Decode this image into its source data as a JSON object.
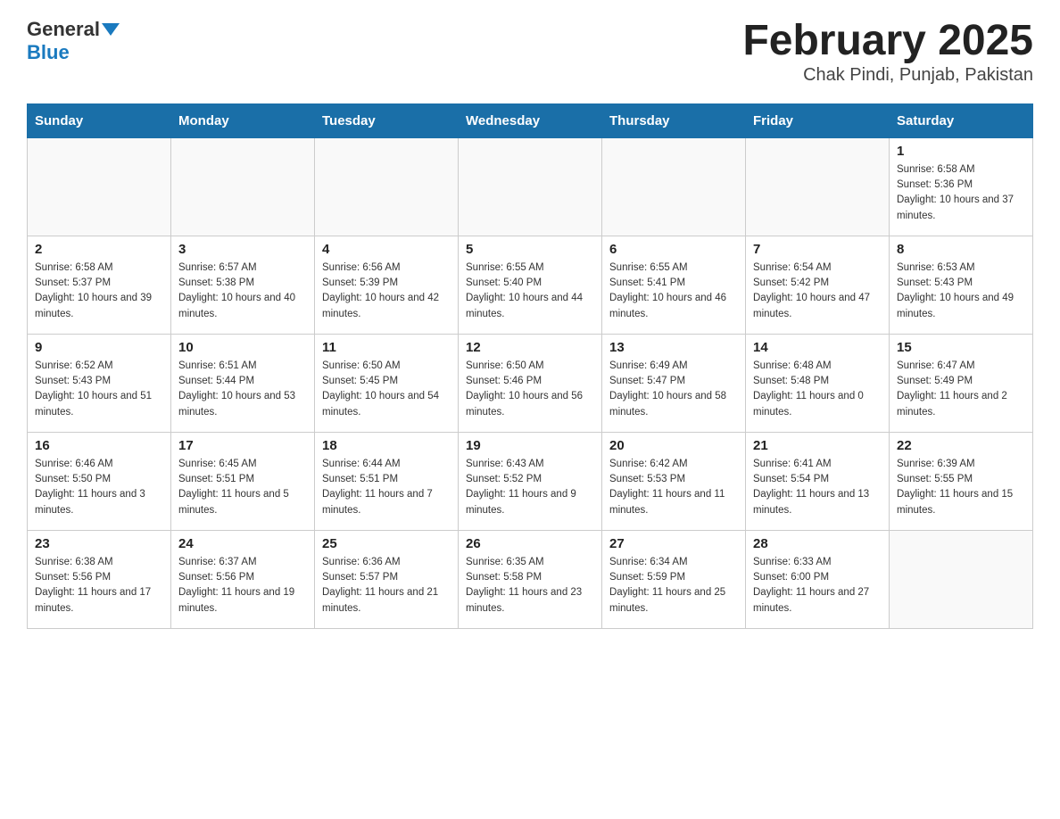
{
  "logo": {
    "text_general": "General",
    "text_blue": "Blue"
  },
  "title": "February 2025",
  "subtitle": "Chak Pindi, Punjab, Pakistan",
  "days_of_week": [
    "Sunday",
    "Monday",
    "Tuesday",
    "Wednesday",
    "Thursday",
    "Friday",
    "Saturday"
  ],
  "weeks": [
    [
      {
        "day": "",
        "info": ""
      },
      {
        "day": "",
        "info": ""
      },
      {
        "day": "",
        "info": ""
      },
      {
        "day": "",
        "info": ""
      },
      {
        "day": "",
        "info": ""
      },
      {
        "day": "",
        "info": ""
      },
      {
        "day": "1",
        "info": "Sunrise: 6:58 AM\nSunset: 5:36 PM\nDaylight: 10 hours and 37 minutes."
      }
    ],
    [
      {
        "day": "2",
        "info": "Sunrise: 6:58 AM\nSunset: 5:37 PM\nDaylight: 10 hours and 39 minutes."
      },
      {
        "day": "3",
        "info": "Sunrise: 6:57 AM\nSunset: 5:38 PM\nDaylight: 10 hours and 40 minutes."
      },
      {
        "day": "4",
        "info": "Sunrise: 6:56 AM\nSunset: 5:39 PM\nDaylight: 10 hours and 42 minutes."
      },
      {
        "day": "5",
        "info": "Sunrise: 6:55 AM\nSunset: 5:40 PM\nDaylight: 10 hours and 44 minutes."
      },
      {
        "day": "6",
        "info": "Sunrise: 6:55 AM\nSunset: 5:41 PM\nDaylight: 10 hours and 46 minutes."
      },
      {
        "day": "7",
        "info": "Sunrise: 6:54 AM\nSunset: 5:42 PM\nDaylight: 10 hours and 47 minutes."
      },
      {
        "day": "8",
        "info": "Sunrise: 6:53 AM\nSunset: 5:43 PM\nDaylight: 10 hours and 49 minutes."
      }
    ],
    [
      {
        "day": "9",
        "info": "Sunrise: 6:52 AM\nSunset: 5:43 PM\nDaylight: 10 hours and 51 minutes."
      },
      {
        "day": "10",
        "info": "Sunrise: 6:51 AM\nSunset: 5:44 PM\nDaylight: 10 hours and 53 minutes."
      },
      {
        "day": "11",
        "info": "Sunrise: 6:50 AM\nSunset: 5:45 PM\nDaylight: 10 hours and 54 minutes."
      },
      {
        "day": "12",
        "info": "Sunrise: 6:50 AM\nSunset: 5:46 PM\nDaylight: 10 hours and 56 minutes."
      },
      {
        "day": "13",
        "info": "Sunrise: 6:49 AM\nSunset: 5:47 PM\nDaylight: 10 hours and 58 minutes."
      },
      {
        "day": "14",
        "info": "Sunrise: 6:48 AM\nSunset: 5:48 PM\nDaylight: 11 hours and 0 minutes."
      },
      {
        "day": "15",
        "info": "Sunrise: 6:47 AM\nSunset: 5:49 PM\nDaylight: 11 hours and 2 minutes."
      }
    ],
    [
      {
        "day": "16",
        "info": "Sunrise: 6:46 AM\nSunset: 5:50 PM\nDaylight: 11 hours and 3 minutes."
      },
      {
        "day": "17",
        "info": "Sunrise: 6:45 AM\nSunset: 5:51 PM\nDaylight: 11 hours and 5 minutes."
      },
      {
        "day": "18",
        "info": "Sunrise: 6:44 AM\nSunset: 5:51 PM\nDaylight: 11 hours and 7 minutes."
      },
      {
        "day": "19",
        "info": "Sunrise: 6:43 AM\nSunset: 5:52 PM\nDaylight: 11 hours and 9 minutes."
      },
      {
        "day": "20",
        "info": "Sunrise: 6:42 AM\nSunset: 5:53 PM\nDaylight: 11 hours and 11 minutes."
      },
      {
        "day": "21",
        "info": "Sunrise: 6:41 AM\nSunset: 5:54 PM\nDaylight: 11 hours and 13 minutes."
      },
      {
        "day": "22",
        "info": "Sunrise: 6:39 AM\nSunset: 5:55 PM\nDaylight: 11 hours and 15 minutes."
      }
    ],
    [
      {
        "day": "23",
        "info": "Sunrise: 6:38 AM\nSunset: 5:56 PM\nDaylight: 11 hours and 17 minutes."
      },
      {
        "day": "24",
        "info": "Sunrise: 6:37 AM\nSunset: 5:56 PM\nDaylight: 11 hours and 19 minutes."
      },
      {
        "day": "25",
        "info": "Sunrise: 6:36 AM\nSunset: 5:57 PM\nDaylight: 11 hours and 21 minutes."
      },
      {
        "day": "26",
        "info": "Sunrise: 6:35 AM\nSunset: 5:58 PM\nDaylight: 11 hours and 23 minutes."
      },
      {
        "day": "27",
        "info": "Sunrise: 6:34 AM\nSunset: 5:59 PM\nDaylight: 11 hours and 25 minutes."
      },
      {
        "day": "28",
        "info": "Sunrise: 6:33 AM\nSunset: 6:00 PM\nDaylight: 11 hours and 27 minutes."
      },
      {
        "day": "",
        "info": ""
      }
    ]
  ]
}
